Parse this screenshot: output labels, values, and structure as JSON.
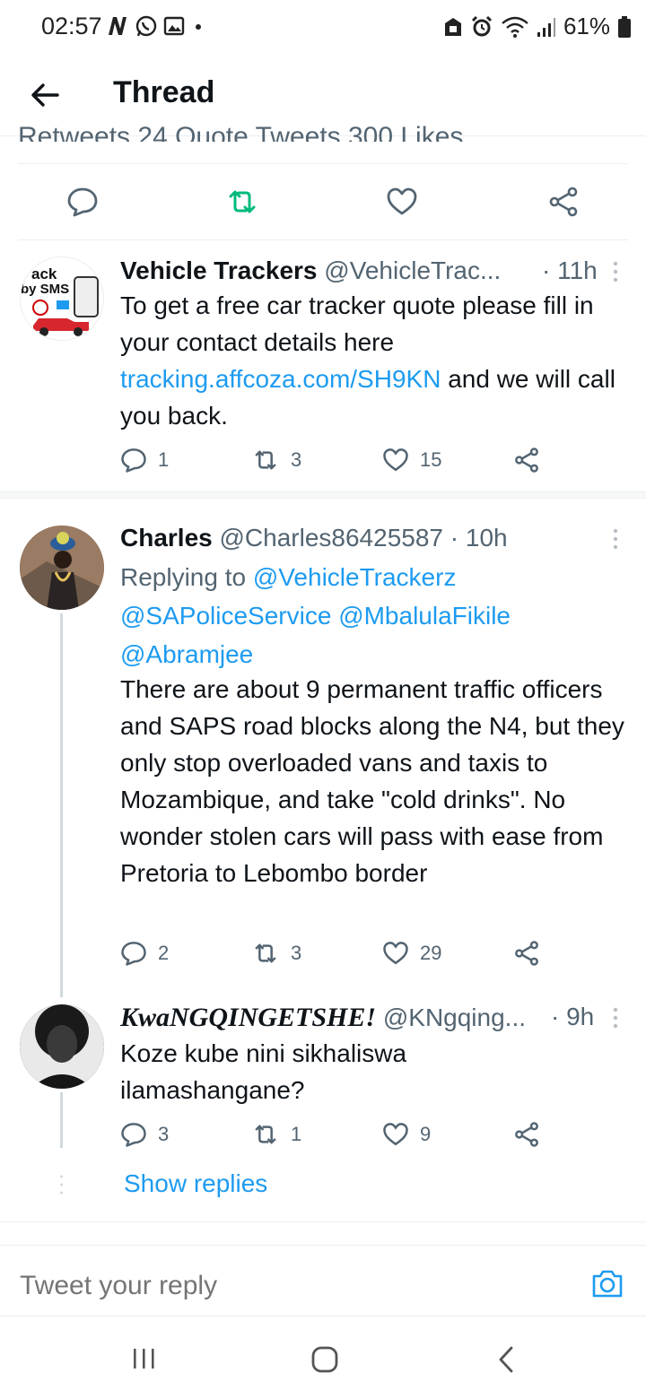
{
  "status_bar": {
    "time": "02:57",
    "battery": "61%",
    "left_icons": [
      "netflix-n-icon",
      "whatsapp-icon",
      "gallery-icon",
      "dot-icon"
    ],
    "right_icons": [
      "vpn-lock-icon",
      "alarm-icon",
      "wifi-icon",
      "signal-icon",
      "battery-icon"
    ]
  },
  "header": {
    "title": "Thread",
    "back_icon": "arrow-left-icon"
  },
  "focused_tweet": {
    "cut_stats_text": "Retweets 24 Quote Tweets 300 Likes",
    "actions": [
      "reply-icon",
      "retweet-icon",
      "like-icon",
      "share-icon"
    ],
    "accent_retweet": "#00ba7c"
  },
  "tweets": [
    {
      "name": "Vehicle Trackers",
      "handle": "@VehicleTrac...",
      "time": "· 11h",
      "avatar_text_1": "ack",
      "avatar_text_2": "by SMS",
      "text_before_link": "To get a free car tracker quote please fill in your contact details here ",
      "link": "tracking.affcoza.com/SH9KN",
      "text_after_link": " and we will call you back.",
      "replies": "1",
      "retweets": "3",
      "likes": "15"
    },
    {
      "name": "Charles",
      "handle": "@Charles86425587",
      "time": "· 10h",
      "replying_prefix": "Replying to ",
      "mention_1": "@VehicleTrackerz",
      "mention_2": "@SAPoliceService",
      "mention_3": "@MbalulaFikile",
      "mention_4": "@Abramjee",
      "text": "There are about 9 permanent traffic officers and SAPS road blocks along the N4, but they only stop overloaded vans and taxis to Mozambique, and take \"cold drinks\". No wonder stolen cars will pass with ease from Pretoria to Lebombo border",
      "replies": "2",
      "retweets": "3",
      "likes": "29"
    },
    {
      "name": "KwaNGQINGETSHE!",
      "handle": "@KNgqing...",
      "time": "· 9h",
      "text": "Koze kube nini sikhaliswa ilamashangane?",
      "replies": "3",
      "retweets": "1",
      "likes": "9"
    }
  ],
  "show_replies": "Show replies",
  "composer": {
    "placeholder": "Tweet your reply",
    "camera_icon": "camera-icon"
  },
  "navbar": [
    "recents-icon",
    "home-icon",
    "back-icon"
  ],
  "colors": {
    "text": "#0f1419",
    "secondary": "#536471",
    "link": "#1d9bf0",
    "divider": "#eceef0"
  }
}
